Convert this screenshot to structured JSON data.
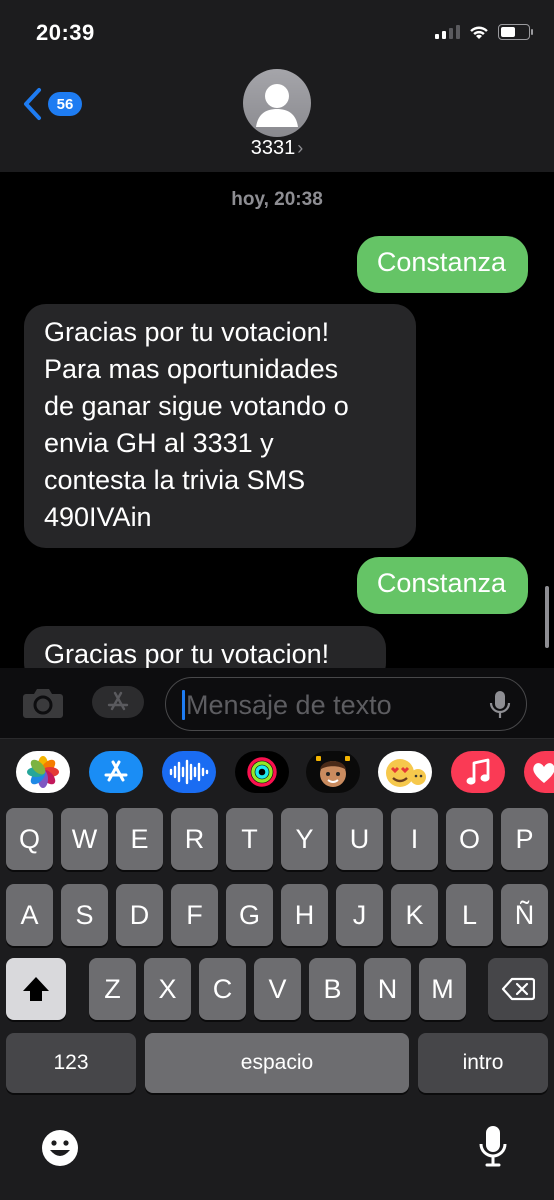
{
  "status_bar": {
    "time": "20:39"
  },
  "header": {
    "back_badge": "56",
    "contact_name": "3331"
  },
  "conversation": {
    "timestamp": "hoy, 20:38",
    "messages": [
      {
        "direction": "outgoing",
        "text": "Constanza"
      },
      {
        "direction": "incoming",
        "text": "Gracias por tu votacion!\nPara mas oportunidades\nde ganar sigue votando o\nenvia GH al 3331 y\ncontesta la trivia SMS\n490IVAin"
      },
      {
        "direction": "outgoing",
        "text": "Constanza"
      },
      {
        "direction": "incoming",
        "text": "Gracias por tu votacion!"
      }
    ]
  },
  "composer": {
    "placeholder": "Mensaje de texto"
  },
  "app_strip": [
    "photos-icon",
    "app-store-icon",
    "audio-message-icon",
    "activity-icon",
    "memoji-icon",
    "animoji-icon",
    "music-icon",
    "heart-icon"
  ],
  "keyboard": {
    "row1": [
      "Q",
      "W",
      "E",
      "R",
      "T",
      "Y",
      "U",
      "I",
      "O",
      "P"
    ],
    "row2": [
      "A",
      "S",
      "D",
      "F",
      "G",
      "H",
      "J",
      "K",
      "L",
      "Ñ"
    ],
    "row3": [
      "Z",
      "X",
      "C",
      "V",
      "B",
      "N",
      "M"
    ],
    "numbers_label": "123",
    "space_label": "espacio",
    "return_label": "intro"
  },
  "colors": {
    "outgoing_bubble": "#65c466",
    "incoming_bubble": "#262628",
    "accent": "#1e7cf2"
  }
}
